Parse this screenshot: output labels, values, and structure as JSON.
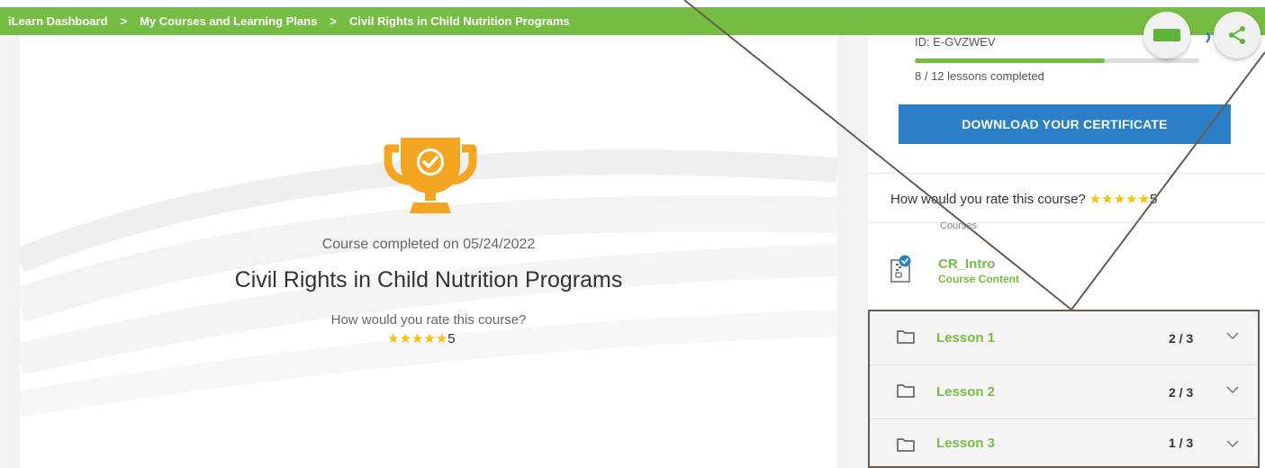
{
  "breadcrumb": {
    "items": [
      "iLearn Dashboard",
      "My Courses and Learning Plans",
      "Civil Rights in Child Nutrition Programs"
    ],
    "separator": ">"
  },
  "main": {
    "icon": "trophy-check-icon",
    "completed_text": "Course completed on 05/24/2022",
    "course_title": "Civil Rights in Child Nutrition Programs",
    "rate_question": "How would you rate this course?",
    "rating_value": "5",
    "stars": 5
  },
  "side": {
    "id_text": "ID: E-GVZWEV",
    "progress_fraction": 0.6667,
    "lessons_completed": "8 / 12 lessons completed",
    "certificate_button": "DOWNLOAD YOUR CERTIFICATE",
    "rate_question": "How would you rate this course?",
    "rating_value": "5",
    "courses_label": "Courses",
    "course_item": {
      "title": "CR_Intro",
      "subtitle": "Course Content",
      "icon": "zip-file-check-icon"
    },
    "lessons": [
      {
        "name": "Lesson 1",
        "count": "2 / 3",
        "icon": "folder-icon"
      },
      {
        "name": "Lesson 2",
        "count": "2 / 3",
        "icon": "folder-icon"
      },
      {
        "name": "Lesson 3",
        "count": "1 / 3",
        "icon": "folder-icon"
      }
    ]
  },
  "colors": {
    "brand_green": "#76bd43",
    "button_blue": "#2b7fc6",
    "star_yellow": "#f5c400",
    "trophy_orange": "#f4a623",
    "annotation_brown": "#6b5a4e"
  },
  "fab": {
    "left_icon": "green-rectangle-icon",
    "right_icon": "share-icon"
  }
}
